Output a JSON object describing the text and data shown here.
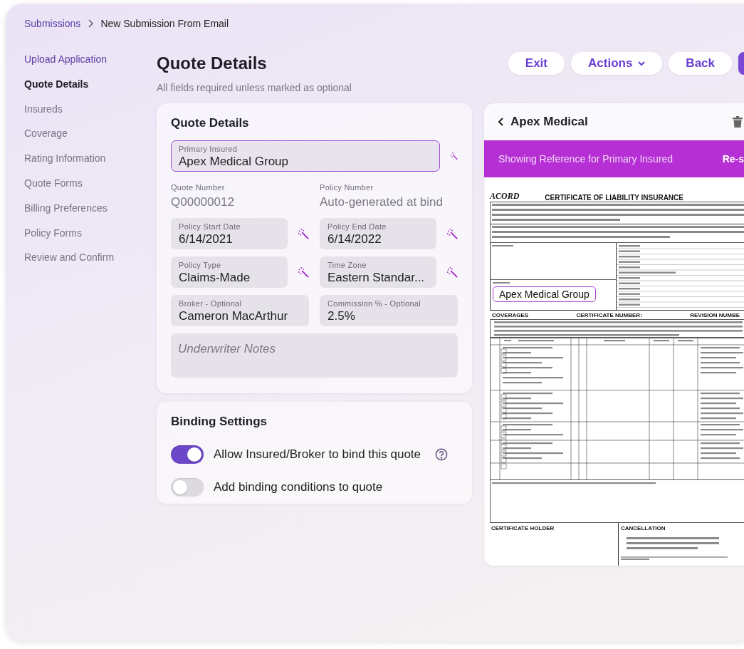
{
  "breadcrumb": [
    {
      "label": "Submissions",
      "kind": "link"
    },
    {
      "label": "New Submission From Email",
      "kind": "current"
    }
  ],
  "sidebar": {
    "items": [
      {
        "label": "Upload Application",
        "selected": false,
        "kind": "done"
      },
      {
        "label": "Quote Details",
        "selected": true,
        "kind": "step"
      },
      {
        "label": "Insureds",
        "selected": false,
        "kind": "step"
      },
      {
        "label": "Coverage",
        "selected": false,
        "kind": "step"
      },
      {
        "label": "Rating Information",
        "selected": false,
        "kind": "step"
      },
      {
        "label": "Quote Forms",
        "selected": false,
        "kind": "step"
      },
      {
        "label": "Billing Preferences",
        "selected": false,
        "kind": "step"
      },
      {
        "label": "Policy Forms",
        "selected": false,
        "kind": "step"
      },
      {
        "label": "Review and Confirm",
        "selected": false,
        "kind": "step"
      }
    ]
  },
  "page": {
    "title": "Quote Details",
    "subtitle": "All fields required unless marked as optional"
  },
  "header_buttons": [
    {
      "label": "Exit",
      "kind": "plain"
    },
    {
      "label": "Actions",
      "kind": "menu"
    },
    {
      "label": "Back",
      "kind": "plain"
    },
    {
      "kind": "primary"
    }
  ],
  "quote_card": {
    "title": "Quote Details",
    "primary_field": {
      "label": "Primary Insured",
      "value": "Apex Medical Group",
      "highlighted": true,
      "suggest": true
    },
    "fields": [
      {
        "label": "Quote Number",
        "value": "Q00000012",
        "kind": "static"
      },
      {
        "label": "Policy Number",
        "value": "Auto-generated at bind",
        "kind": "static"
      },
      {
        "label": "Policy Start Date",
        "value": "6/14/2021",
        "kind": "input",
        "suggest": true,
        "highlighted": false
      },
      {
        "label": "Policy End Date",
        "value": "6/14/2022",
        "kind": "input",
        "suggest": true,
        "highlighted": false
      },
      {
        "label": "Policy Type",
        "value": "Claims-Made",
        "kind": "input",
        "suggest": true,
        "highlighted": false
      },
      {
        "label": "Time Zone",
        "value": "Eastern Standar...",
        "kind": "input",
        "suggest": true,
        "highlighted": false
      },
      {
        "label": "Broker - Optional",
        "value": "Cameron MacArthur",
        "kind": "input",
        "suggest": false,
        "highlighted": false
      },
      {
        "label": "Commission % - Optional",
        "value": "2.5%",
        "kind": "input",
        "suggest": false,
        "highlighted": false
      }
    ],
    "notes": {
      "placeholder": "Underwriter Notes"
    }
  },
  "binding_card": {
    "title": "Binding Settings",
    "toggles": [
      {
        "label": "Allow Insured/Broker to bind this quote",
        "on": true,
        "help": true
      },
      {
        "label": "Add binding conditions to quote",
        "on": false,
        "help": false
      }
    ]
  },
  "reference_panel": {
    "title": "Apex Medical",
    "banner": "Showing Reference for Primary Insured",
    "banner_action": "Re-s",
    "document": {
      "logo": "ACORD",
      "title": "CERTIFICATE OF LIABILITY INSURANCE",
      "insured_value": "Apex Medical Group",
      "coverages_label": "COVERAGES",
      "certificate_number_label": "CERTIFICATE NUMBER:",
      "revision_label": "REVISION NUMBE",
      "holder_label": "CERTIFICATE HOLDER",
      "cancellation_label": "CANCELLATION"
    }
  }
}
